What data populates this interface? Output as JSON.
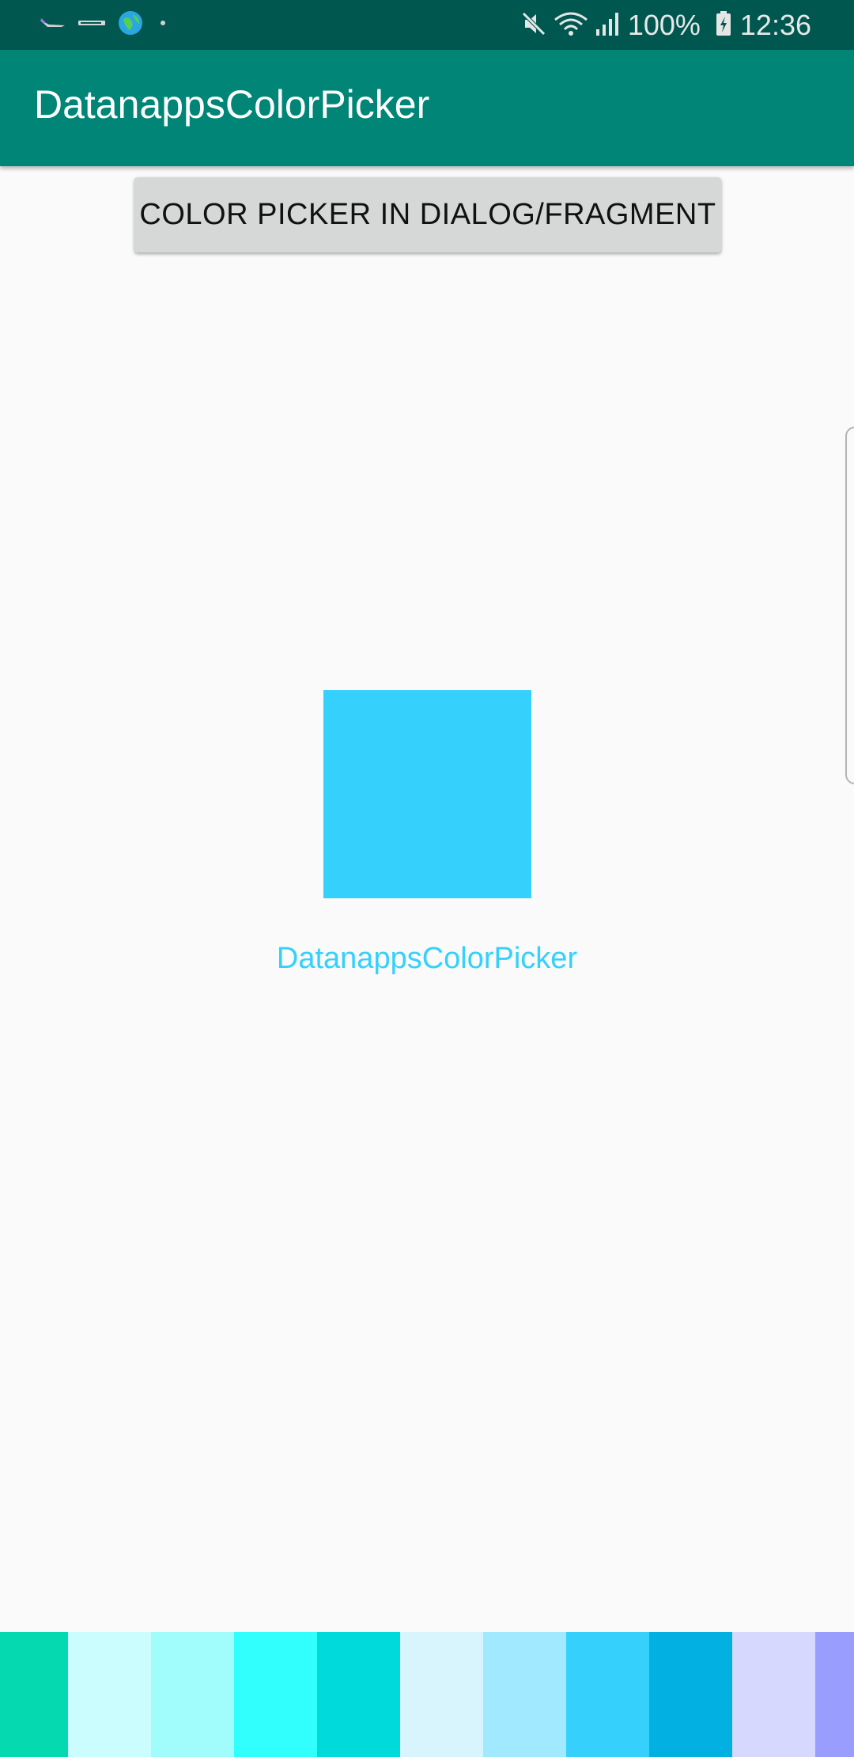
{
  "status_bar": {
    "notification_icons": [
      "bird-notification-icon",
      "brand-notification-icon",
      "globe-notification-icon",
      "dot-notification-icon"
    ],
    "battery_percent": "100%",
    "time": "12:36"
  },
  "app_bar": {
    "title": "DatanappsColorPicker"
  },
  "main": {
    "picker_button_label": "COLOR PICKER IN DIALOG/FRAGMENT",
    "selected_color": "#35d0fc",
    "label": "DatanappsColorPicker",
    "label_color": "#35d0fc"
  },
  "colors": {
    "status_bar": "#00574f",
    "app_bar": "#008577",
    "background": "#fafafa",
    "button": "#d6d7d7"
  },
  "swatches": [
    "#04d9b0",
    "#ccfdfe",
    "#a1fcfc",
    "#30fffe",
    "#00dada",
    "#d8f5fe",
    "#a0e9fe",
    "#35d0fc",
    "#02b0e1",
    "#d7d8fe",
    "#999dfe"
  ]
}
